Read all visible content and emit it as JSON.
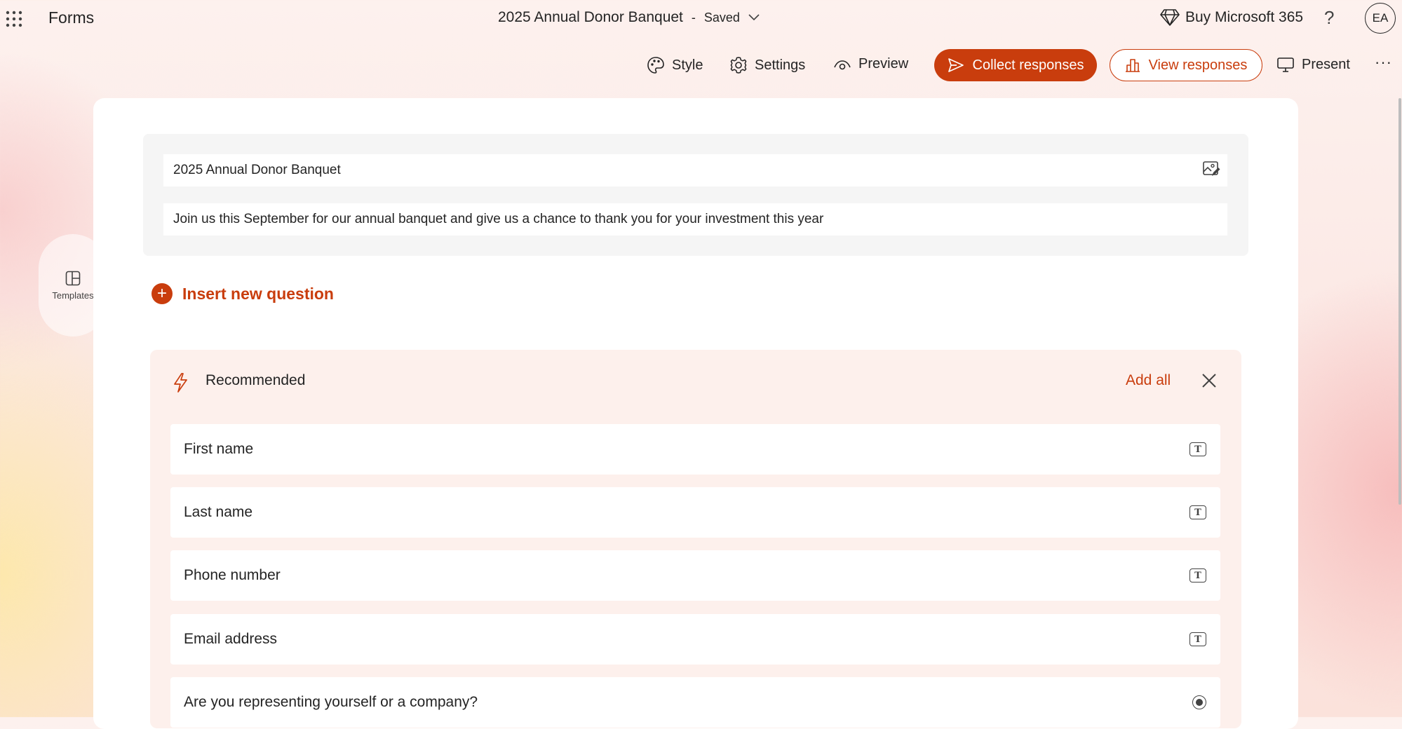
{
  "app": {
    "name": "Forms"
  },
  "document": {
    "title": "2025 Annual Donor Banquet",
    "separator": "-",
    "status": "Saved"
  },
  "header": {
    "buy_label": "Buy Microsoft 365",
    "help_label": "?",
    "avatar_initials": "EA"
  },
  "toolbar": {
    "style_label": "Style",
    "settings_label": "Settings",
    "preview_label": "Preview",
    "collect_label": "Collect responses",
    "view_label": "View responses",
    "present_label": "Present",
    "more_label": "···"
  },
  "sidebar": {
    "templates_label": "Templates"
  },
  "form": {
    "title": "2025 Annual Donor Banquet",
    "description": "Join us this September for our annual banquet and give us a chance to thank you for your investment this year"
  },
  "insert_label": "Insert new question",
  "recommended": {
    "label": "Recommended",
    "add_all_label": "Add all",
    "items": [
      {
        "label": "First name",
        "icon": "text-icon"
      },
      {
        "label": "Last name",
        "icon": "text-icon"
      },
      {
        "label": "Phone number",
        "icon": "text-icon"
      },
      {
        "label": "Email address",
        "icon": "text-icon"
      },
      {
        "label": "Are you representing yourself or a company?",
        "icon": "radio-icon"
      }
    ]
  },
  "colors": {
    "accent": "#c93d0d",
    "panel": "#fdf0ec",
    "card": "#ffffff"
  }
}
